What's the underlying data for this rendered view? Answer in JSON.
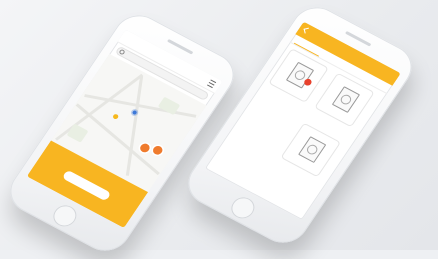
{
  "left_phone": {
    "header_title": "",
    "search_placeholder": "",
    "sheet_text": "",
    "sheet_button": ""
  },
  "right_phone": {
    "header_title": "",
    "tabs": [
      "",
      ""
    ],
    "cards": [
      {
        "label": "",
        "badge": ""
      },
      {
        "label": "",
        "badge": ""
      },
      {
        "label": "",
        "badge": ""
      }
    ],
    "footer_note": ""
  },
  "colors": {
    "accent": "#f8b521",
    "pin": "#ef7b2d",
    "badge": "#e8412c"
  }
}
